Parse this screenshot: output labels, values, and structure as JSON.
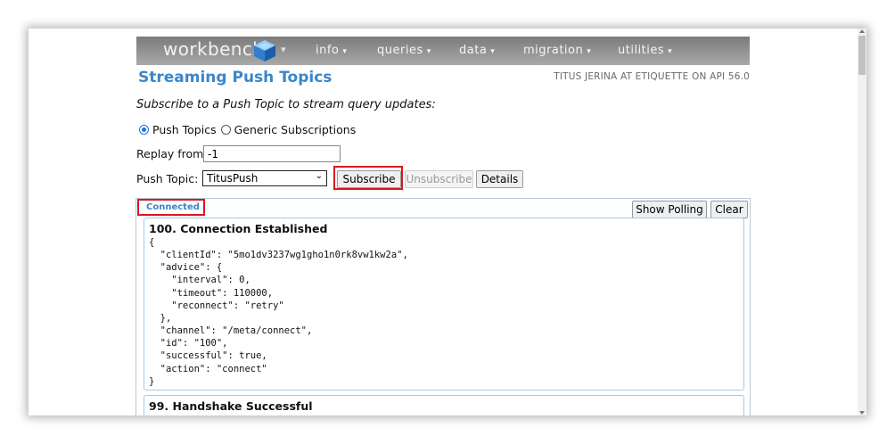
{
  "navbar": {
    "logo": "workbench",
    "logo_caret": "▾",
    "items": [
      {
        "label": "info",
        "caret": "▾"
      },
      {
        "label": "queries",
        "caret": "▾"
      },
      {
        "label": "data",
        "caret": "▾"
      },
      {
        "label": "migration",
        "caret": "▾"
      },
      {
        "label": "utilities",
        "caret": "▾"
      }
    ]
  },
  "header": {
    "title": "Streaming Push Topics",
    "user_info": "TITUS JERINA AT ETIQUETTE ON API 56.0"
  },
  "form": {
    "intro": "Subscribe to a Push Topic to stream query updates:",
    "mode_options": [
      {
        "label": "Push Topics",
        "checked": true
      },
      {
        "label": "Generic Subscriptions",
        "checked": false
      }
    ],
    "replay_label": "Replay from:",
    "replay_value": "-1",
    "topic_label": "Push Topic:",
    "topic_value": "TitusPush",
    "subscribe_label": "Subscribe",
    "unsubscribe_label": "Unsubscribe",
    "details_label": "Details"
  },
  "output": {
    "status": "Connected",
    "show_polling_label": "Show Polling",
    "clear_label": "Clear",
    "messages": [
      {
        "title": "100. Connection Established",
        "lines": [
          "{",
          "  \"clientId\": \"5mo1dv3237wg1gho1n0rk8vw1kw2a\",",
          "  \"advice\": {",
          "    \"interval\": 0,",
          "    \"timeout\": 110000,",
          "    \"reconnect\": \"retry\"",
          "  },",
          "  \"channel\": \"/meta/connect\",",
          "  \"id\": \"100\",",
          "  \"successful\": true,",
          "  \"action\": \"connect\"",
          "}"
        ]
      },
      {
        "title": "99. Handshake Successful",
        "lines": [
          "{"
        ]
      }
    ]
  },
  "colors": {
    "title_blue": "#3a86c8",
    "highlight_red": "#d8181f",
    "cube_blue": "#3b8fd9"
  },
  "icons": {
    "logo": "cube-icon",
    "dropdown": "chevron-down-icon"
  }
}
